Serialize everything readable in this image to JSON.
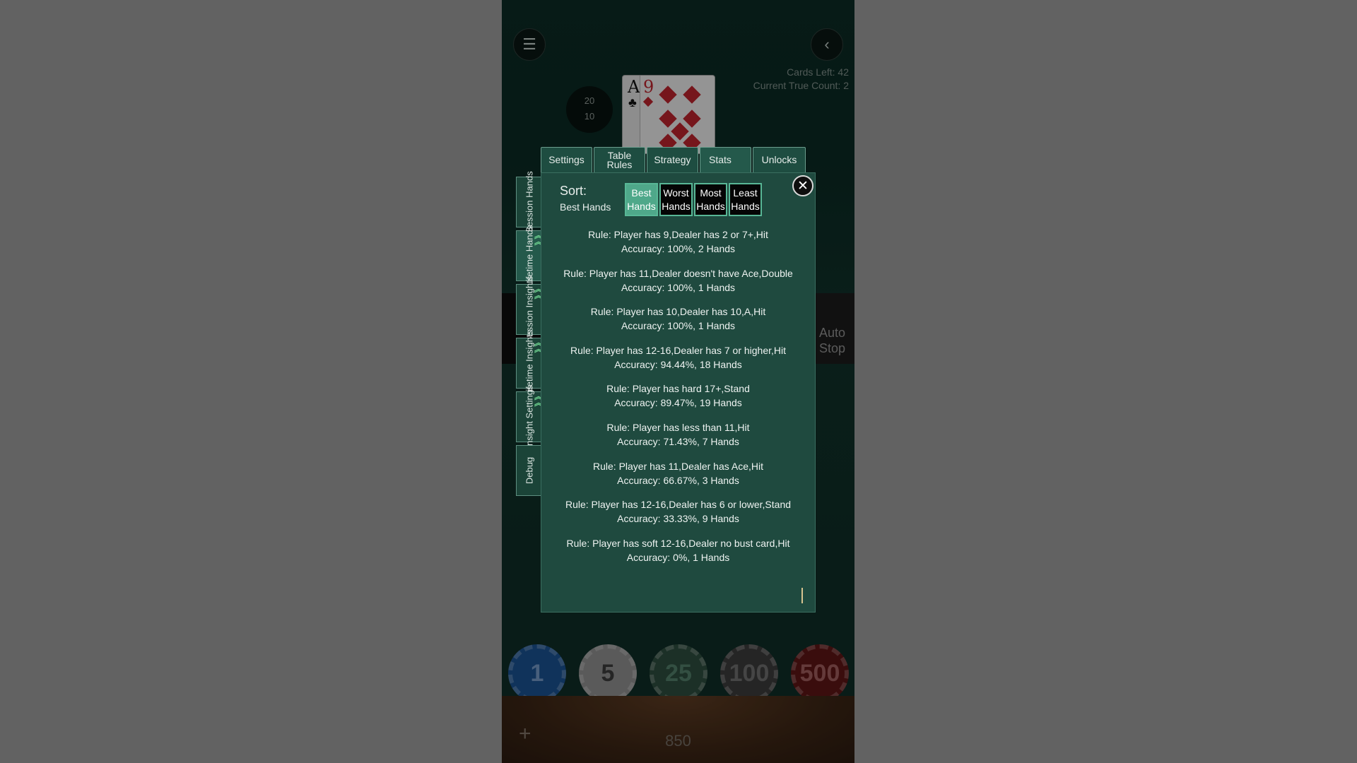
{
  "header": {
    "cards_left": "Cards Left: 42",
    "true_count": "Current True Count: 2"
  },
  "table": {
    "score_top": "20",
    "score_bottom": "10",
    "dealer_card_1": "A",
    "dealer_card_2": "9",
    "auto_stop": "Auto Stop",
    "chips": [
      "1",
      "5",
      "25",
      "100",
      "500"
    ],
    "bankroll": "850"
  },
  "tabs": [
    {
      "label": "Settings"
    },
    {
      "label": "Table Rules"
    },
    {
      "label": "Strategy"
    },
    {
      "label": "Stats",
      "active": true
    },
    {
      "label": "Unlocks"
    }
  ],
  "side_tabs": [
    {
      "label": "Session Hands"
    },
    {
      "label": "Lifetime Hands",
      "active": true,
      "badge": true
    },
    {
      "label": "Session Insights",
      "badge": true
    },
    {
      "label": "Lifetime Insights",
      "badge": true
    },
    {
      "label": "Insight Settings",
      "badge": true
    },
    {
      "label": "Debug"
    }
  ],
  "sort": {
    "title": "Sort:",
    "current": "Best Hands",
    "buttons": [
      {
        "line1": "Best",
        "line2": "Hands",
        "active": true
      },
      {
        "line1": "Worst",
        "line2": "Hands"
      },
      {
        "line1": "Most",
        "line2": "Hands"
      },
      {
        "line1": "Least",
        "line2": "Hands"
      }
    ]
  },
  "rules": [
    {
      "rule": "Rule: Player has 9,Dealer has 2 or 7+,Hit",
      "accuracy": "Accuracy: 100%, 2 Hands"
    },
    {
      "rule": "Rule: Player has 11,Dealer doesn't have Ace,Double",
      "accuracy": "Accuracy: 100%, 1 Hands"
    },
    {
      "rule": "Rule: Player has 10,Dealer has 10,A,Hit",
      "accuracy": "Accuracy: 100%, 1 Hands"
    },
    {
      "rule": "Rule: Player has 12-16,Dealer has 7 or higher,Hit",
      "accuracy": "Accuracy: 94.44%, 18 Hands"
    },
    {
      "rule": "Rule: Player has hard 17+,Stand",
      "accuracy": "Accuracy: 89.47%, 19 Hands"
    },
    {
      "rule": "Rule: Player has less than 11,Hit",
      "accuracy": "Accuracy: 71.43%, 7 Hands"
    },
    {
      "rule": "Rule: Player has 11,Dealer has Ace,Hit",
      "accuracy": "Accuracy: 66.67%, 3 Hands"
    },
    {
      "rule": "Rule: Player has 12-16,Dealer has 6 or lower,Stand",
      "accuracy": "Accuracy: 33.33%, 9 Hands"
    },
    {
      "rule": "Rule: Player has soft 12-16,Dealer no bust card,Hit",
      "accuracy": "Accuracy: 0%, 1 Hands"
    }
  ],
  "colors": {
    "panel_bg": "#1f4a3f",
    "accent": "#4fa88a",
    "badge": "#6ed18f"
  }
}
